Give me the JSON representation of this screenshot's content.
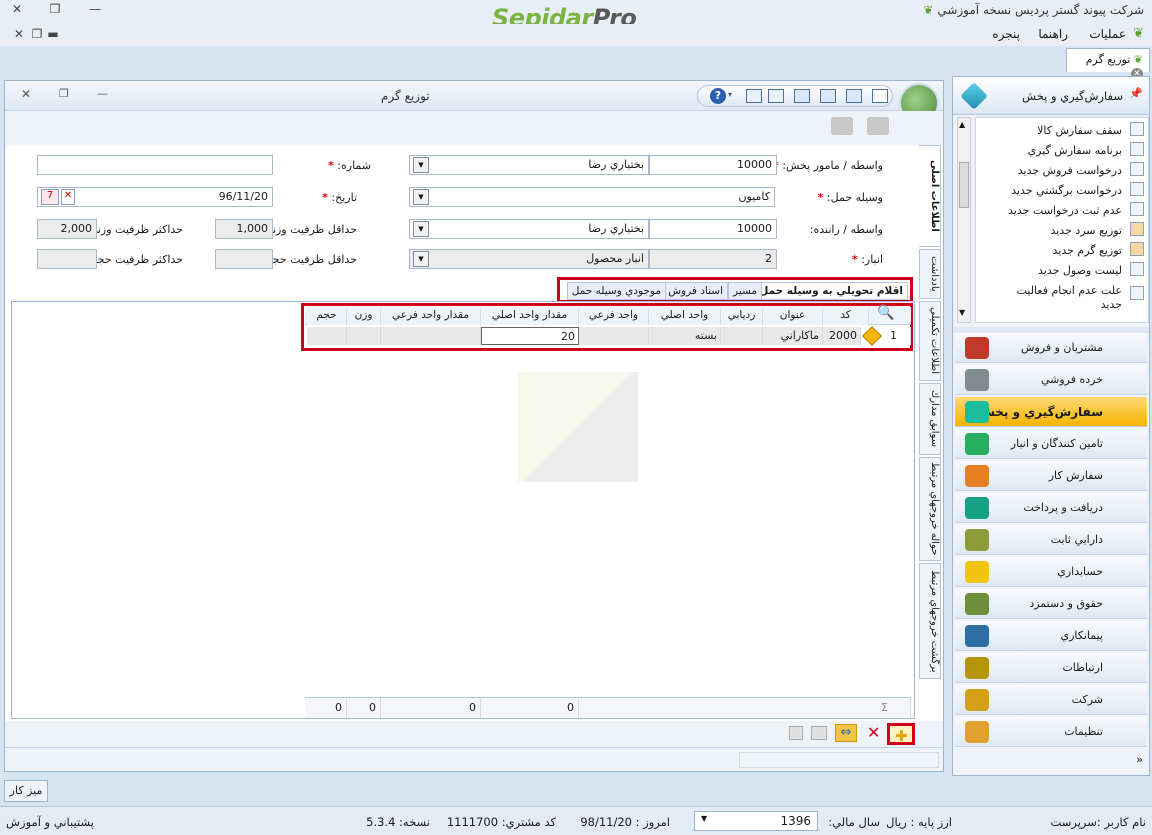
{
  "app": {
    "window_title": "شرکت پیوند گستر پردیس نسخه آموزشي",
    "brand_part1": "Sepidar",
    "brand_part2": "Pro"
  },
  "menu": {
    "items": [
      "عمليات",
      "راهنما",
      "پنجره"
    ]
  },
  "doc_tab": {
    "label": "توزيع گرم"
  },
  "inner": {
    "title": "توزيع گرم"
  },
  "form": {
    "agent_label": "واسطه / مامور پخش:",
    "agent_code": "10000",
    "agent_name": "بختياري رضا",
    "number_label": "شماره:",
    "number_value": "",
    "vehicle_label": "وسيله حمل:",
    "vehicle_value": "كاميون",
    "date_label": "تاريخ:",
    "date_value": "96/11/20",
    "driver_label": "واسطه / راننده:",
    "driver_code": "10000",
    "driver_name": "بختياري رضا",
    "min_weight_label": "حداقل ظرفيت وزني:",
    "min_weight_value": "1,000",
    "max_weight_label": "حداكثر ظرفيت وزني:",
    "max_weight_value": "2,000",
    "store_label": "انبار:",
    "store_code": "2",
    "store_name": "انبار محصول",
    "min_volume_label": "حداقل ظرفيت حجمي:",
    "min_volume_value": "",
    "max_volume_label": "حداكثر ظرفيت حجمي:",
    "max_volume_value": ""
  },
  "vertical_tabs": [
    "اطلاعات اصلی",
    "يادداشت",
    "اطلاعات تكميلي",
    "سوابق مدارك",
    "حواله خروجهاي مرتبط",
    "برگشت خروجهاي مرتبط"
  ],
  "sub_tabs": [
    "اقلام تحويلي به وسيله حمل",
    "مسير",
    "اسناد فروش",
    "موجودي وسيله حمل"
  ],
  "grid": {
    "columns": [
      "كد",
      "عنوان",
      "رديابي",
      "واحد اصلي",
      "واحد فرعي",
      "مقدار واحد اصلي",
      "مقدار واحد فرعي",
      "وزن",
      "حجم"
    ],
    "rows": [
      {
        "index": "1",
        "code": "2000",
        "title": "ماكاراني",
        "tracking": "",
        "main_unit": "بسته",
        "sub_unit": "",
        "main_qty": "20",
        "sub_qty": "",
        "weight": "",
        "volume": ""
      }
    ],
    "sums": {
      "sigma": "Σ",
      "main_qty": "0",
      "sub_qty": "0",
      "weight": "0",
      "volume": "0"
    }
  },
  "right_panel": {
    "header": "سفارش‌گيري و پخش",
    "links": [
      "سقف سفارش كالا",
      "برنامه سفارش گيري",
      "درخواست فروش جديد",
      "درخواست برگشتي جديد",
      "عدم ثبت درخواست جديد",
      "توزيع سرد جديد",
      "توزيع گرم جديد",
      "ليست وصول جديد",
      "علت عدم انجام فعاليت",
      "جديد"
    ],
    "nav": [
      "مشتريان و فروش",
      "خرده فروشي",
      "سفارش‌گيري و پخش",
      "تامين كنندگان و انبار",
      "سفارش كار",
      "دريافت و پرداخت",
      "دارايي ثابت",
      "حسابداري",
      "حقوق و دستمزد",
      "پيمانكاري",
      "ارتباطات",
      "شركت",
      "تنظيمات"
    ],
    "nav_colors": [
      "#c0392b",
      "#7f8c8d",
      "#1abc9c",
      "#27ae60",
      "#e67e22",
      "#16a085",
      "#8e9b3a",
      "#f1c40f",
      "#6d8f3a",
      "#2c6ea5",
      "#b7950b",
      "#d4a017",
      "#e0a030"
    ]
  },
  "desktop_button": "ميز كار",
  "status": {
    "user": "نام كاربر :سرپرست",
    "base_currency": "ارز پايه :  ريال",
    "fiscal_year_label": "سال مالي:",
    "fiscal_year": "1396",
    "today": "امروز :   98/11/20",
    "customer_code": "كد مشتري:   1111700",
    "version": "نسخه:   5.3.4",
    "support": "پشتيباني و آموزش"
  }
}
